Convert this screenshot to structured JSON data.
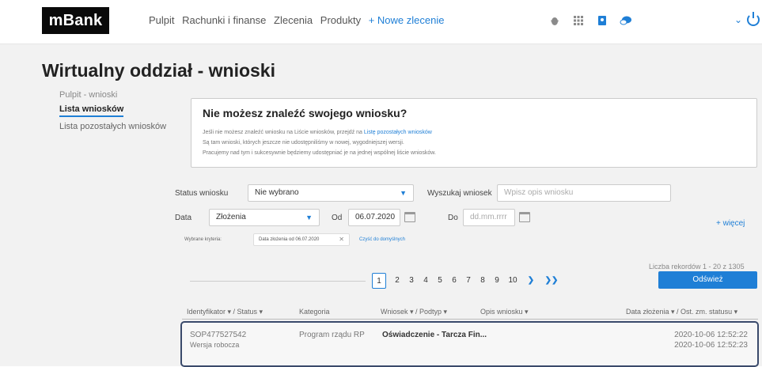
{
  "header": {
    "logo": "mBank",
    "nav": [
      "Pulpit",
      "Rachunki i finanse",
      "Zlecenia",
      "Produkty"
    ],
    "new_order": "+ Nowe zlecenie",
    "icons": [
      "bug-icon",
      "grid-icon",
      "user-book-icon",
      "chat-icon",
      "chevron-down-icon",
      "power-icon"
    ]
  },
  "page": {
    "title": "Wirtualny oddział - wnioski"
  },
  "sidebar": {
    "items": [
      {
        "label": "Pulpit - wnioski"
      },
      {
        "label": "Lista wniosków"
      },
      {
        "label": "Lista pozostałych wniosków"
      }
    ]
  },
  "info": {
    "title": "Nie możesz znaleźć swojego wniosku?",
    "line1_pre": "Jeśli nie możesz znaleźć wniosku na Liście wniosków, przejdź na ",
    "line1_link": "Listę pozostałych wniosków",
    "line2": "Są tam wnioski, których jeszcze nie udostępniliśmy w nowej, wygodniejszej wersji.",
    "line3": "Pracujemy nad tym i sukcesywnie będziemy udostępniać je na jednej wspólnej liście wniosków."
  },
  "filters": {
    "status_label": "Status wniosku",
    "status_value": "Nie wybrano",
    "search_label": "Wyszukaj wniosek",
    "search_placeholder": "Wpisz opis wniosku",
    "date_label": "Data",
    "date_type": "Złożenia",
    "from_label": "Od",
    "from_value": "06.07.2020",
    "to_label": "Do",
    "to_placeholder": "dd.mm.rrrr",
    "more": "+ więcej"
  },
  "criteria": {
    "label": "Wybrane kryteria:",
    "chip": "Data złożenia od 06.07.2020",
    "reset": "Czyść do domyślnych"
  },
  "records": {
    "count": "Liczba rekordów 1 - 20 z 1305",
    "refresh": "Odśwież"
  },
  "pager": {
    "pages": [
      "1",
      "2",
      "3",
      "4",
      "5",
      "6",
      "7",
      "8",
      "9",
      "10"
    ],
    "current": "1",
    "next": "❯",
    "last": "❯❯"
  },
  "table": {
    "headers": {
      "id": "Identyfikator ▾ / Status ▾",
      "category": "Kategoria",
      "type": "Wniosek ▾ / Podtyp ▾",
      "desc": "Opis wniosku ▾",
      "date": "Data złożenia ▾ / Ost. zm. statusu ▾"
    },
    "rows": [
      {
        "id": "SOP477527542",
        "status": "Wersja robocza",
        "category": "Program rządu RP",
        "type": "Oświadczenie - Tarcza Fin...",
        "date_submitted": "2020-10-06 12:52:22",
        "date_changed": "2020-10-06 12:52:23"
      }
    ]
  }
}
